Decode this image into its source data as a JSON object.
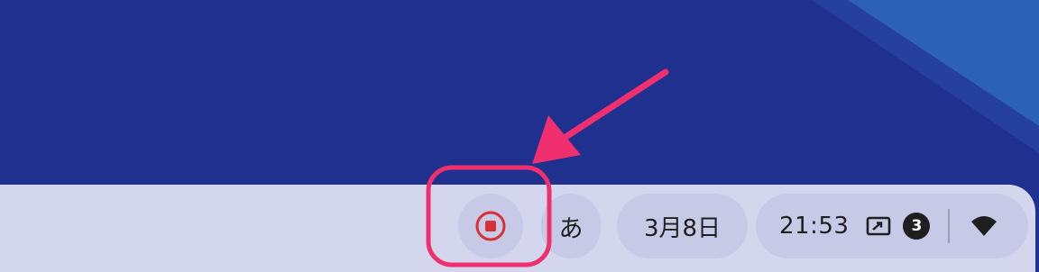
{
  "shelf": {
    "ime_label": "あ",
    "date": "3月8日",
    "time": "21:53",
    "notification_count": "3"
  },
  "icons": {
    "record": "stop-recording-icon",
    "cast": "screen-cast-icon",
    "wifi": "wifi-icon"
  },
  "colors": {
    "wallpaper": "#20308f",
    "shelf": "#d4d6ee",
    "pill": "#c7cae6",
    "record_red": "#d93035",
    "annotation_pink": "#f0306e"
  }
}
